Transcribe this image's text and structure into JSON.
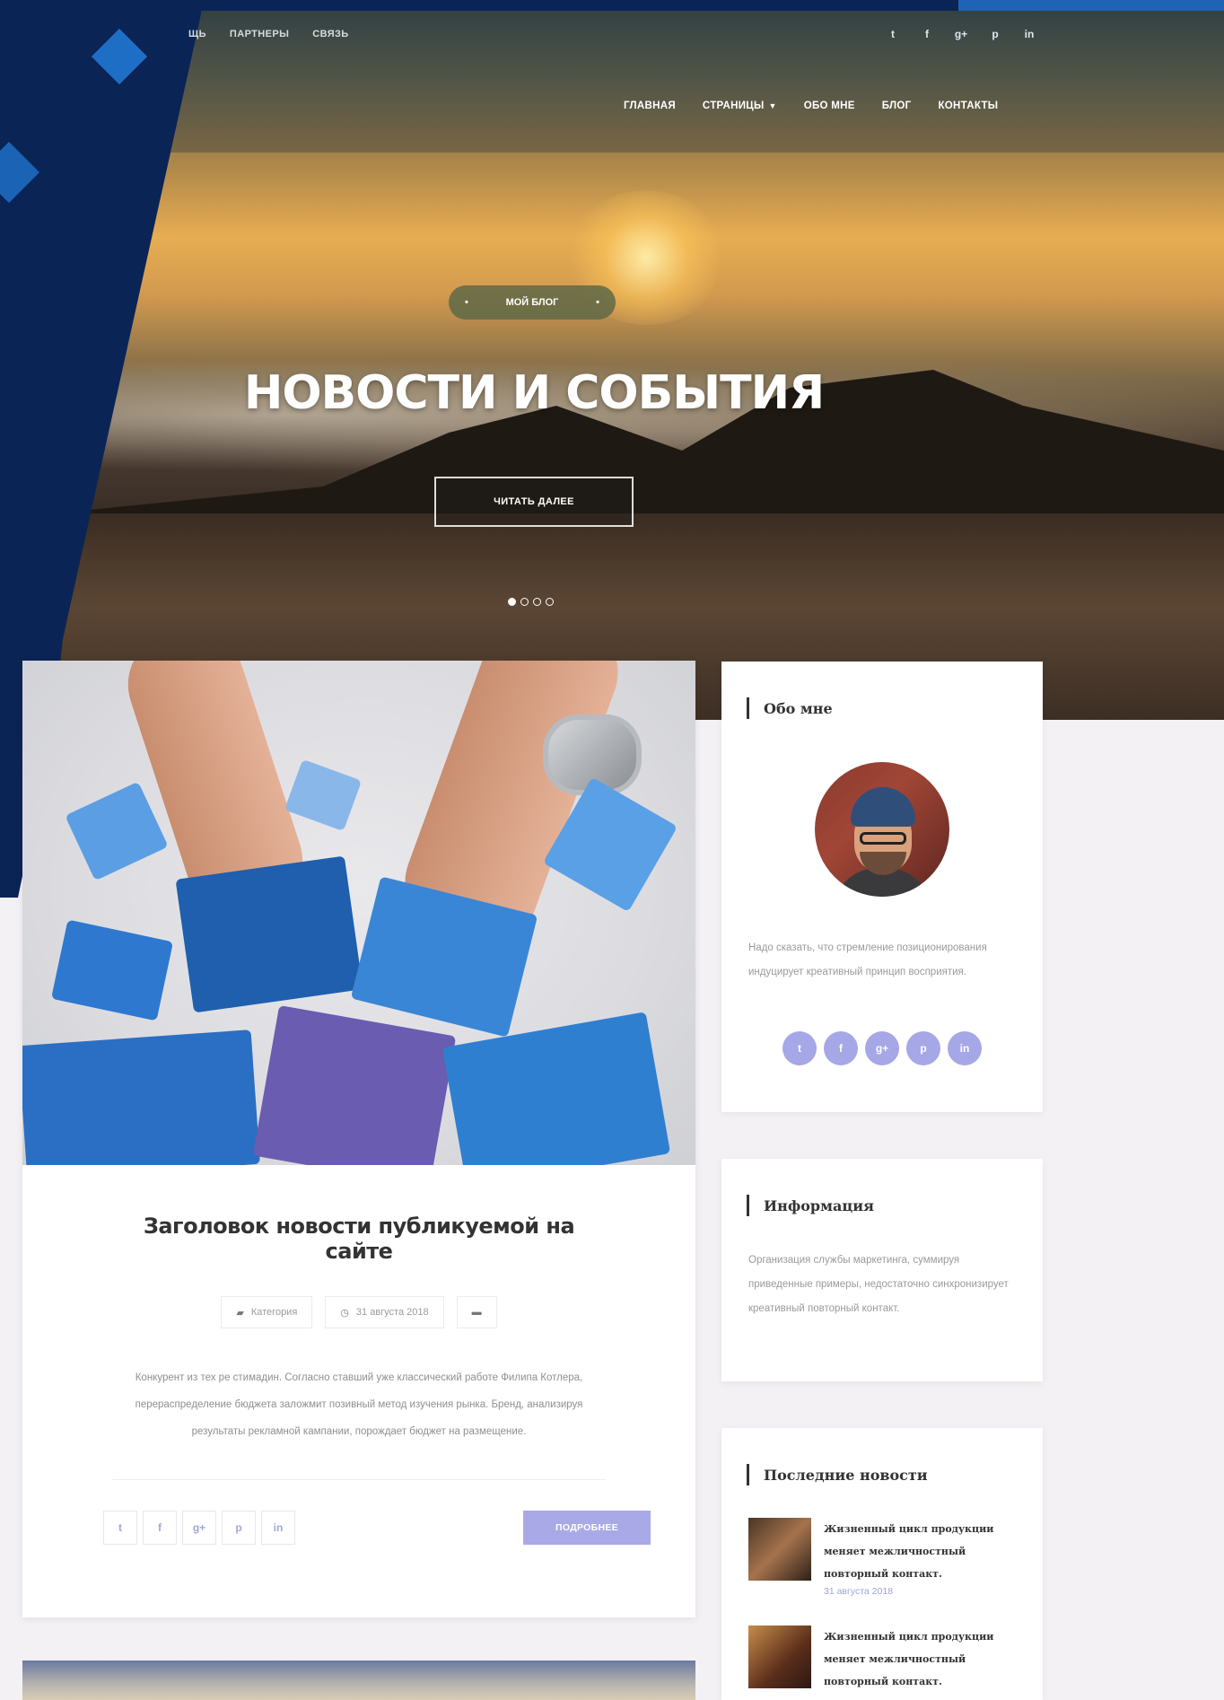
{
  "topbar": {
    "links": [
      "ЩЬ",
      "ПАРТНЕРЫ",
      "СВЯЗЬ"
    ],
    "social": [
      "t",
      "f",
      "g+",
      "p",
      "in"
    ]
  },
  "nav": {
    "items": [
      "ГЛАВНАЯ",
      "СТРАНИЦЫ",
      "ОБО МНЕ",
      "БЛОГ",
      "КОНТАКТЫ"
    ],
    "caret": "▼"
  },
  "hero": {
    "badge": "МОЙ БЛОГ",
    "title": "НОВОСТИ И СОБЫТИЯ",
    "button": "ЧИТАТЬ ДАЛЕЕ",
    "slide_count": 4,
    "active_slide": 1
  },
  "article": {
    "title": "Заголовок новости публикуемой на сайте",
    "category": "Категория",
    "date": "31 августа 2018",
    "excerpt": "Конкурент из тех ре стимадин. Согласно ставший уже классический работе Филипа Котлера, перераспределение бюджета заложмит позивный метод изучения рынка. Бренд, анализируя результаты рекламной кампании, порождает бюджет на размещение.",
    "share": [
      "t",
      "f",
      "g+",
      "p",
      "in"
    ],
    "more_button": "ПОДРОБНЕЕ"
  },
  "sidebar": {
    "about": {
      "title": "Обо мне",
      "text": "Надо сказать, что стремление позиционирования индуцирует креативный принцип восприятия.",
      "social": [
        "t",
        "f",
        "g+",
        "p",
        "in"
      ]
    },
    "info": {
      "title": "Информация",
      "text": "Организация службы маркетинга, суммируя приведенные примеры, недостаточно синхронизирует креативный повторный контакт."
    },
    "news": {
      "title": "Последние новости",
      "items": [
        {
          "headline": "Жизненный цикл продукции меняет межличностный повторный контакт.",
          "date": "31 августа 2018"
        },
        {
          "headline": "Жизненный цикл продукции меняет межличностный повторный контакт.",
          "date": ""
        }
      ]
    }
  },
  "colors": {
    "navy": "#0b2456",
    "accent_blue": "#1f6ec6",
    "lavender": "#a8a9e6"
  }
}
